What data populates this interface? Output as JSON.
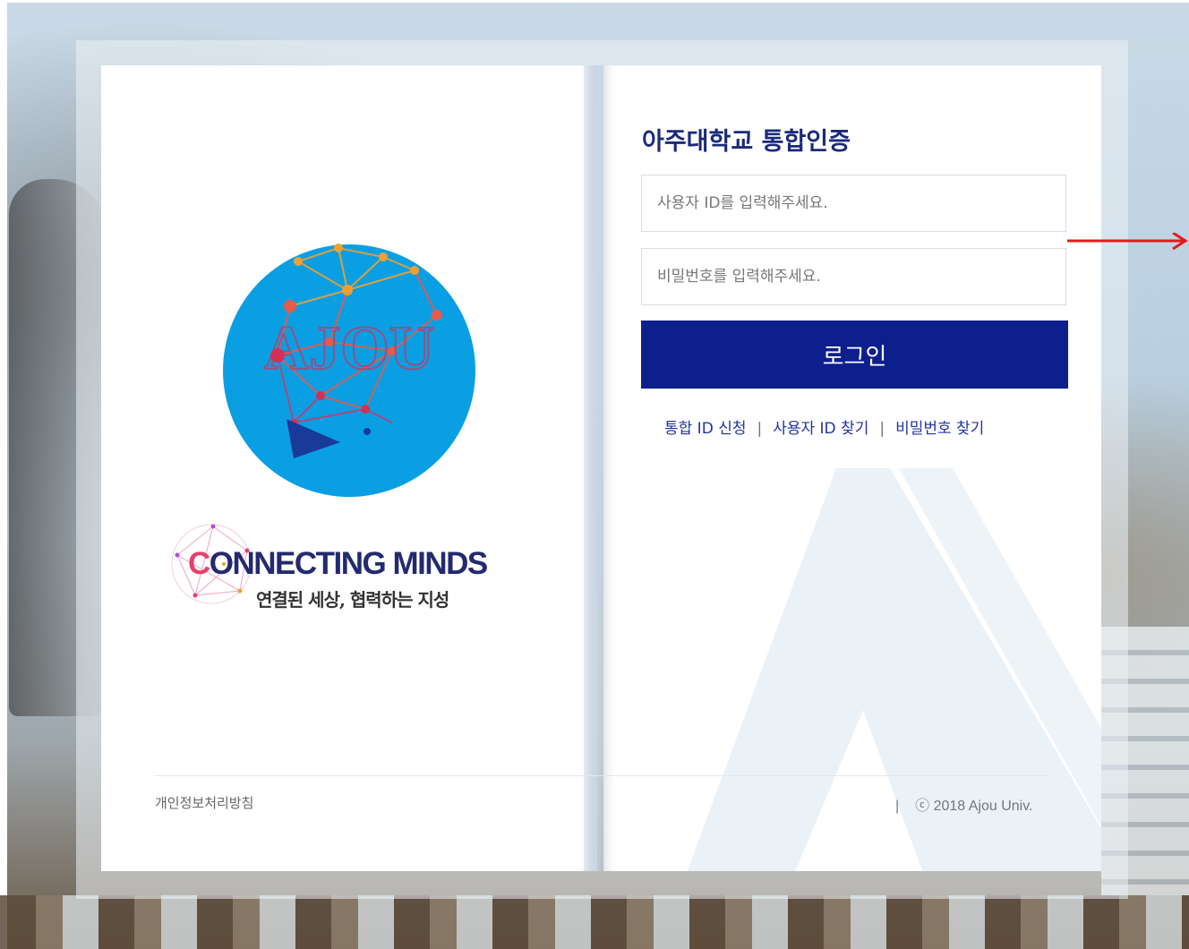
{
  "login": {
    "title": "아주대학교 통합인증",
    "user_id_placeholder": "사용자 ID를 입력해주세요.",
    "password_placeholder": "비밀번호를 입력해주세요.",
    "login_button": "로그인"
  },
  "links": {
    "register": "통합 ID 신청",
    "find_id": "사용자 ID 찾기",
    "find_password": "비밀번호 찾기",
    "separator": "|"
  },
  "branding": {
    "slogan_first_letter": "C",
    "slogan_rest": "ONNECTING MINDS",
    "slogan_subtitle": "연결된 세상, 협력하는 지성",
    "logo_text": "AJOU"
  },
  "footer": {
    "privacy_policy": "개인정보처리방침",
    "separator": "|",
    "copyright": "ⓒ 2018 Ajou Univ."
  },
  "colors": {
    "primary": "#0d1f8c",
    "title": "#1b2a7a",
    "link": "#2233a6",
    "logo_circle": "#0a9fe3",
    "annotation_arrow": "#e31b1b"
  }
}
